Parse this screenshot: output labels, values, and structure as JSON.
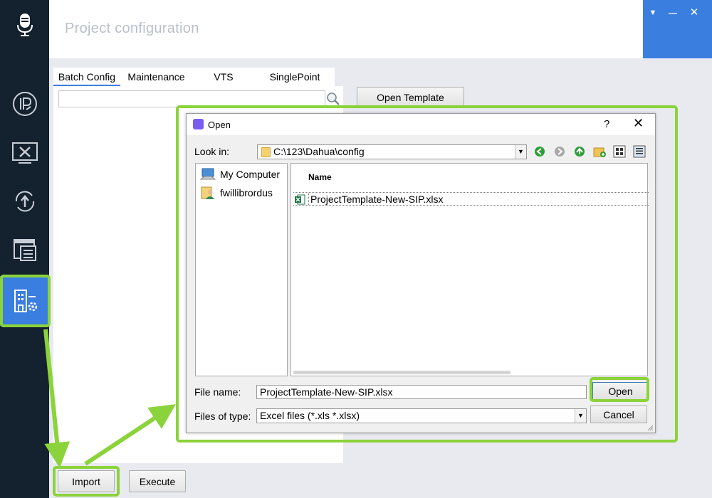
{
  "header": {
    "title": "Project configuration"
  },
  "window_controls": {
    "menu": "▼",
    "minimize": "—",
    "close": "✕"
  },
  "sidebar": {
    "items": [
      {
        "icon": "microphone-icon"
      },
      {
        "icon": "ip-icon"
      },
      {
        "icon": "tools-monitor-icon"
      },
      {
        "icon": "upload-cycle-icon"
      },
      {
        "icon": "document-list-icon"
      },
      {
        "icon": "building-settings-icon",
        "active": true
      }
    ]
  },
  "tabs": [
    {
      "label": "Batch Config",
      "active": true
    },
    {
      "label": "Maintenance"
    },
    {
      "label": "VTS"
    },
    {
      "label": "SinglePoint"
    }
  ],
  "search": {
    "placeholder": ""
  },
  "toolbar": {
    "open_template_label": "Open Template"
  },
  "bottom": {
    "import_label": "Import",
    "execute_label": "Execute"
  },
  "dialog": {
    "title": "Open",
    "help": "?",
    "close": "✕",
    "look_in_label": "Look in:",
    "look_in_value": "C:\\123\\Dahua\\config",
    "places": [
      {
        "label": "My Computer",
        "icon": "computer-icon"
      },
      {
        "label": "fwillibrordus",
        "icon": "user-folder-icon"
      }
    ],
    "columns": {
      "name": "Name"
    },
    "files": [
      {
        "name": "ProjectTemplate-New-SIP.xlsx",
        "icon": "excel-file-icon"
      }
    ],
    "file_name_label": "File name:",
    "file_name_value": "ProjectTemplate-New-SIP.xlsx",
    "file_type_label": "Files of type:",
    "file_type_value": "Excel files (*.xls *.xlsx)",
    "open_label": "Open",
    "cancel_label": "Cancel"
  },
  "colors": {
    "accent": "#3a7ee0",
    "sidebar": "#14212e",
    "highlight": "#8bd33a"
  }
}
